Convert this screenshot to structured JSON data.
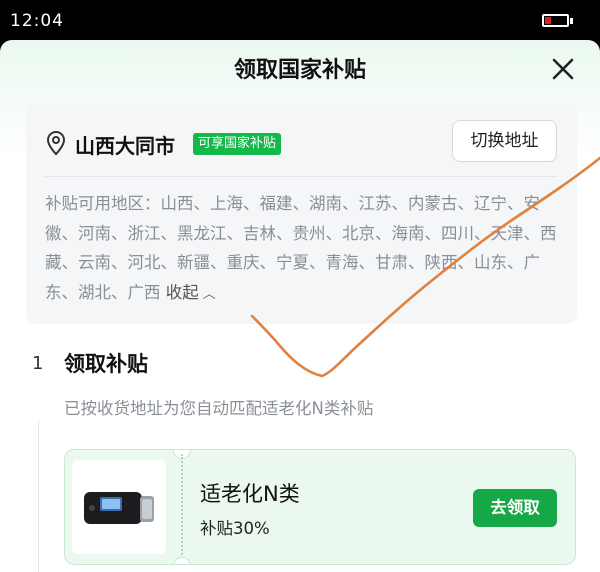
{
  "status_bar": {
    "time": "12:04",
    "battery_color": "#e02020"
  },
  "sheet": {
    "title": "领取国家补贴",
    "close_icon": "close-icon"
  },
  "address": {
    "pin_icon": "location-pin-icon",
    "city": "山西大同市",
    "badge": "可享国家补贴",
    "badge_color": "#15b84a",
    "switch_label": "切换地址",
    "regions_text": "补贴可用地区：山西、上海、福建、湖南、江苏、内蒙古、辽宁、安徽、河南、浙江、黑龙江、吉林、贵州、北京、海南、四川、天津、西藏、云南、河北、新疆、重庆、宁夏、青海、甘肃、陕西、山东、广东、湖北、广西",
    "collapse_label": "收起",
    "collapse_icon": "chevron-up-icon"
  },
  "step": {
    "number": "1",
    "title": "领取补贴",
    "description": "已按收货地址为您自动匹配适老化N类补贴"
  },
  "subsidy": {
    "product_image_icon": "cpap-device-image",
    "name": "适老化N类",
    "rate": "补贴30%",
    "claim_label": "去领取",
    "accent_color": "#16a846"
  },
  "annotation": {
    "stroke_color": "#e0813f"
  }
}
